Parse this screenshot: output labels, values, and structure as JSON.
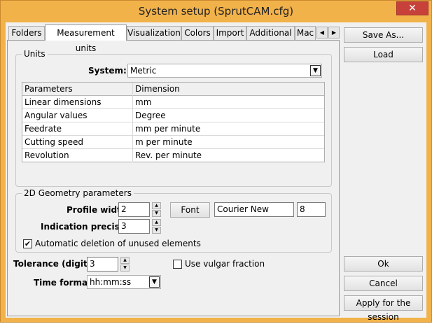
{
  "window": {
    "title": "System setup (SprutCAM.cfg)",
    "close_glyph": "✕"
  },
  "tabs": [
    {
      "label": "Folders"
    },
    {
      "label": "Measurement units",
      "active": true
    },
    {
      "label": "Visualization"
    },
    {
      "label": "Colors"
    },
    {
      "label": "Import"
    },
    {
      "label": "Additional"
    },
    {
      "label": "Mac"
    }
  ],
  "units": {
    "group_label": "Units",
    "system_label": "System:",
    "system_value": "Metric",
    "grid_headers": [
      "Parameters",
      "Dimension"
    ],
    "rows": [
      {
        "param": "Linear dimensions",
        "dim": "mm"
      },
      {
        "param": "Angular values",
        "dim": "Degree"
      },
      {
        "param": "Feedrate",
        "dim": "mm per minute"
      },
      {
        "param": "Cutting speed",
        "dim": "m per minute"
      },
      {
        "param": "Revolution",
        "dim": "Rev. per minute"
      }
    ]
  },
  "geometry": {
    "group_label": "2D Geometry parameters",
    "profile_width_label": "Profile width:",
    "profile_width": "2",
    "indication_precision_label": "Indication precision:",
    "indication_precision": "3",
    "font_button": "Font",
    "font_name": "Courier New",
    "font_size": "8",
    "auto_delete_label": "Automatic deletion of unused elements",
    "auto_delete_checked": true
  },
  "tolerance": {
    "label": "Tolerance (digits):",
    "value": "3"
  },
  "vulgar_fraction": {
    "label": "Use vulgar fraction",
    "checked": false
  },
  "time_format": {
    "label": "Time format:",
    "value": "hh:mm:ss"
  },
  "side_buttons": {
    "save_as": "Save As...",
    "load": "Load",
    "ok": "Ok",
    "cancel": "Cancel",
    "apply": "Apply for the session"
  }
}
